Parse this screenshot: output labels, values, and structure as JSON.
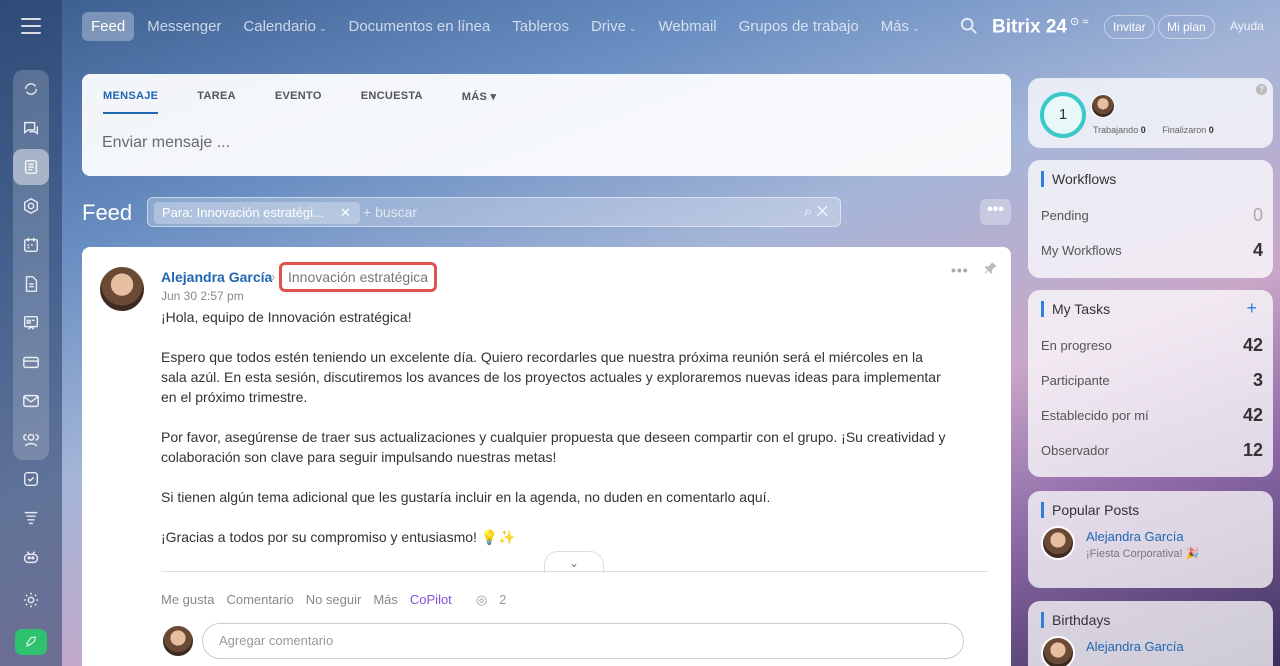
{
  "topbar": {
    "nav": [
      {
        "label": "Feed",
        "active": true
      },
      {
        "label": "Messenger"
      },
      {
        "label": "Calendario",
        "caret": true
      },
      {
        "label": "Documentos en línea"
      },
      {
        "label": "Tableros"
      },
      {
        "label": "Drive",
        "caret": true
      },
      {
        "label": "Webmail"
      },
      {
        "label": "Grupos de trabajo"
      },
      {
        "label": "Más",
        "caret": true
      }
    ],
    "brand": "Bitrix 24",
    "invite": "Invitar",
    "plan": "Mi plan",
    "help": "Ayuda"
  },
  "composer": {
    "tabs": [
      "MENSAJE",
      "TAREA",
      "EVENTO",
      "ENCUESTA",
      "MÁS ▾"
    ],
    "placeholder": "Enviar mensaje ..."
  },
  "feed": {
    "title": "Feed",
    "filter_tag": "Para: Innovación estratégi...",
    "search_placeholder": "+ buscar"
  },
  "post": {
    "author": "Alejandra García",
    "destination": "Innovación estratégica",
    "date": "Jun 30 2:57 pm",
    "paragraphs": [
      "¡Hola, equipo de Innovación estratégica!",
      "Espero que todos estén teniendo un excelente día. Quiero recordarles que nuestra próxima reunión será el miércoles en la sala azúl. En esta sesión, discutiremos los avances de los proyectos actuales y exploraremos nuevas ideas para implementar en el próximo trimestre.",
      "Por favor, asegúrense de traer sus actualizaciones y cualquier propuesta que deseen compartir con el grupo. ¡Su creatividad y colaboración son clave para seguir impulsando nuestras metas!",
      "Si tienen algún tema adicional que les gustaría incluir en la agenda, no duden en comentarlo aquí.",
      "¡Gracias a todos por su compromiso y entusiasmo! 💡✨"
    ],
    "actions": {
      "like": "Me gusta",
      "comment": "Comentario",
      "unfollow": "No seguir",
      "more": "Más",
      "copilot": "CoPilot",
      "views": "2"
    },
    "comment_placeholder": "Agregar comentario"
  },
  "timeman": {
    "count": "1",
    "working_label": "Trabajando",
    "working_value": "0",
    "finished_label": "Finalizaron",
    "finished_value": "0"
  },
  "workflows": {
    "title": "Workflows",
    "rows": [
      {
        "label": "Pending",
        "value": "0"
      },
      {
        "label": "My Workflows",
        "value": "4"
      }
    ]
  },
  "tasks": {
    "title": "My Tasks",
    "rows": [
      {
        "label": "En progreso",
        "value": "42"
      },
      {
        "label": "Participante",
        "value": "3"
      },
      {
        "label": "Establecido por mí",
        "value": "42"
      },
      {
        "label": "Observador",
        "value": "12"
      }
    ]
  },
  "popular": {
    "title": "Popular Posts",
    "name": "Alejandra García",
    "subtitle": "¡Fiesta Corporativa! 🎉"
  },
  "birthdays": {
    "title": "Birthdays",
    "name": "Alejandra García"
  }
}
